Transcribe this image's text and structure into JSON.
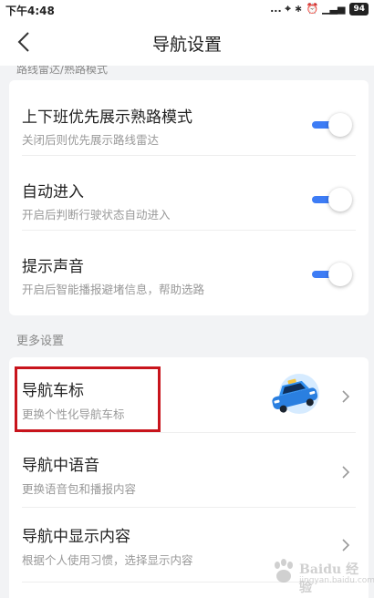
{
  "status_bar": {
    "time": "下午4:48",
    "icons": "... ⌖ ∗ ⏰ ▁▃▅",
    "battery": "94"
  },
  "nav": {
    "title": "导航设置"
  },
  "partial_section_label": "路线雷达/熟路模式",
  "toggles": [
    {
      "title": "上下班优先展示熟路模式",
      "subtitle": "关闭后则优先展示路线雷达",
      "on": true
    },
    {
      "title": "自动进入",
      "subtitle": "开启后判断行驶状态自动进入",
      "on": true
    },
    {
      "title": "提示声音",
      "subtitle": "开启后智能播报避堵信息，帮助选路",
      "on": true
    }
  ],
  "more_section": {
    "label": "更多设置"
  },
  "more_items": [
    {
      "title": "导航车标",
      "subtitle": "更换个性化导航车标"
    },
    {
      "title": "导航中语音",
      "subtitle": "更换语音包和播报内容"
    },
    {
      "title": "导航中显示内容",
      "subtitle": "根据个人使用习惯，选择显示内容"
    }
  ],
  "colors": {
    "accent": "#3d7cf5",
    "highlight": "#c8141c",
    "background": "#f2f3f5"
  },
  "watermark": {
    "text": "Baidu 经验",
    "sub": "jingyan.baidu.com"
  }
}
